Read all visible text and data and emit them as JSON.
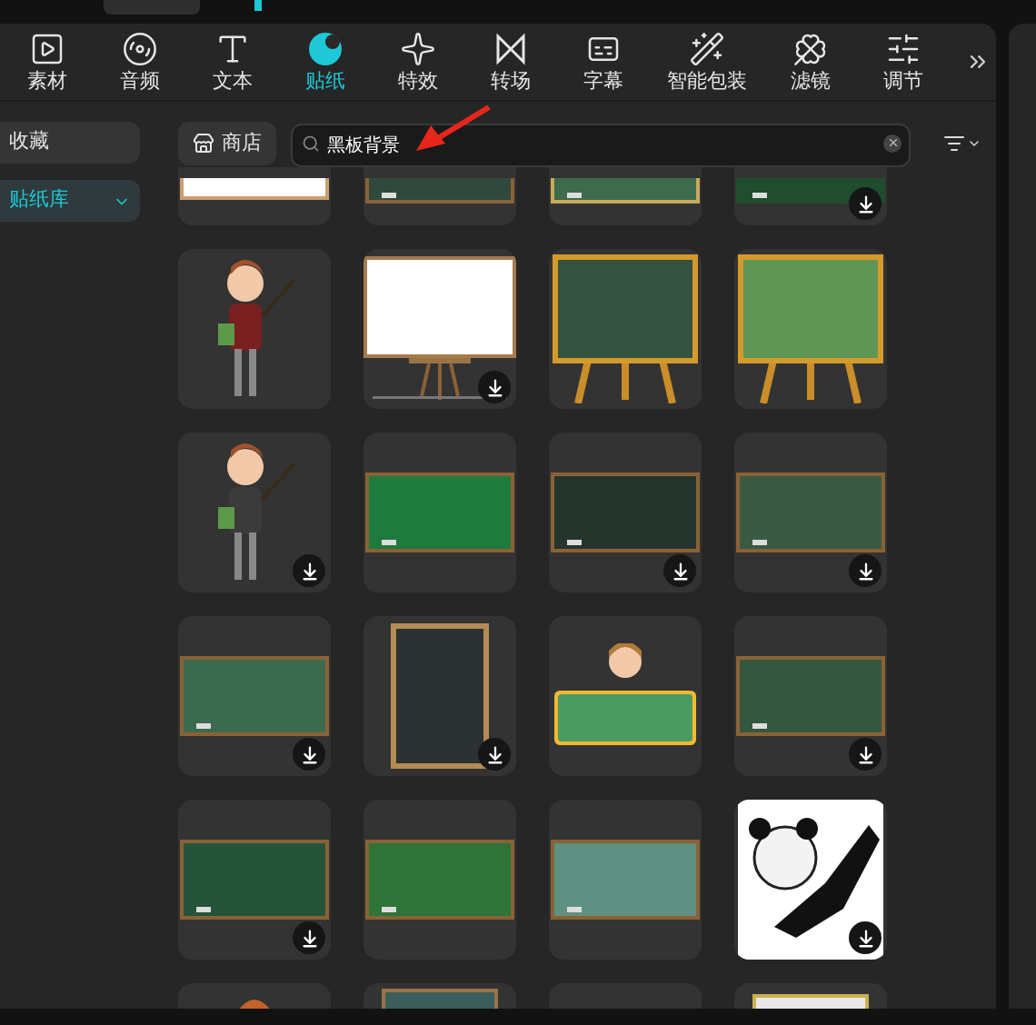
{
  "tabs": [
    {
      "label": "素材",
      "selected": false
    },
    {
      "label": "音频",
      "selected": false
    },
    {
      "label": "文本",
      "selected": false
    },
    {
      "label": "贴纸",
      "selected": true
    },
    {
      "label": "特效",
      "selected": false
    },
    {
      "label": "转场",
      "selected": false
    },
    {
      "label": "字幕",
      "selected": false
    },
    {
      "label": "智能包装",
      "selected": false
    },
    {
      "label": "滤镜",
      "selected": false
    },
    {
      "label": "调节",
      "selected": false
    }
  ],
  "sidebar": {
    "items": [
      {
        "label": "收藏",
        "selected": false
      },
      {
        "label": "贴纸库",
        "selected": true
      }
    ]
  },
  "shop_button": {
    "label": "商店"
  },
  "search": {
    "value": "黑板背景"
  },
  "stickers": [
    {
      "kind": "picture",
      "download": false
    },
    {
      "kind": "picture",
      "download": false
    },
    {
      "kind": "picture",
      "download": false
    },
    {
      "kind": "picture",
      "download": true
    },
    {
      "kind": "picture",
      "download": false
    },
    {
      "kind": "picture",
      "download": true
    },
    {
      "kind": "picture",
      "download": false
    },
    {
      "kind": "picture",
      "download": false
    },
    {
      "kind": "picture",
      "download": true
    },
    {
      "kind": "picture",
      "download": false
    },
    {
      "kind": "picture",
      "download": true
    },
    {
      "kind": "picture",
      "download": true
    },
    {
      "kind": "picture",
      "download": true
    },
    {
      "kind": "picture",
      "download": true
    },
    {
      "kind": "picture",
      "download": false
    },
    {
      "kind": "picture",
      "download": true
    },
    {
      "kind": "picture",
      "download": true
    },
    {
      "kind": "picture",
      "download": false
    },
    {
      "kind": "picture",
      "download": false
    },
    {
      "kind": "picture",
      "download": true
    },
    {
      "kind": "picture"
    },
    {
      "kind": "picture"
    },
    {
      "kind": "empty"
    },
    {
      "kind": "picture"
    }
  ]
}
